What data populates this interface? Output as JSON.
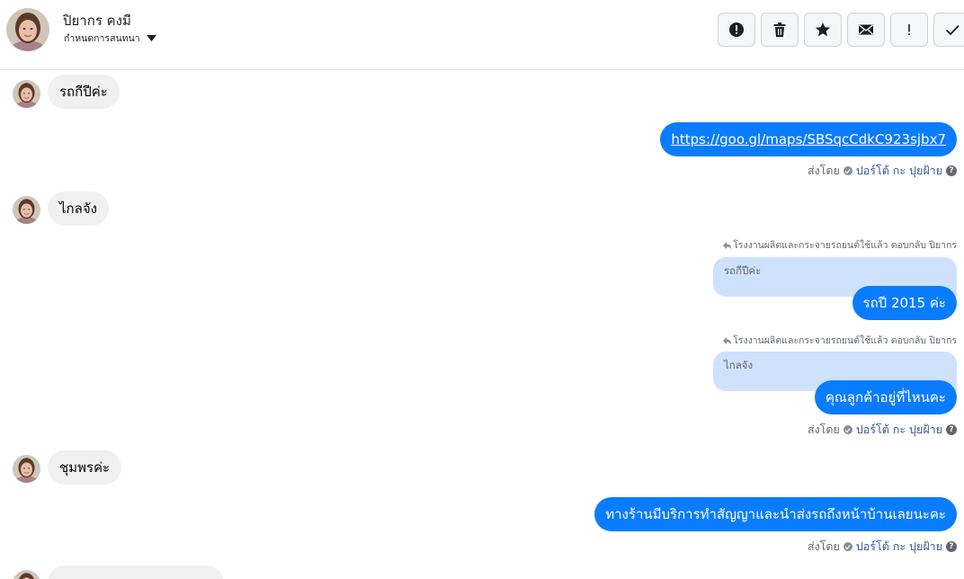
{
  "header": {
    "contact_name": "ปิยากร คงมี",
    "subtitle": "กำหนดการสนทนา",
    "actions": [
      {
        "icon": "alert-icon",
        "name": "mark-spam-button"
      },
      {
        "icon": "trash-icon",
        "name": "delete-button"
      },
      {
        "icon": "star-icon",
        "name": "star-button"
      },
      {
        "icon": "envelope-icon",
        "name": "mark-unread-button"
      },
      {
        "icon": "exclamation-icon",
        "name": "follow-up-button"
      },
      {
        "icon": "check-icon",
        "name": "done-button"
      }
    ]
  },
  "messages": {
    "m1": "รถกีปีค่ะ",
    "m2": "https://goo.gl/maps/SBSqcCdkC923sjbx7",
    "m3": "ไกลจัง",
    "m4_reply_note": "โรงงานผลิตและกระจายรถยนต์ใช้แล้ว ตอบกลับ ปิยากร",
    "m4_quote": "รถกีปีค่ะ",
    "m4": "รถปี 2015 ค่ะ",
    "m5_reply_note": "โรงงานผลิตและกระจายรถยนต์ใช้แล้ว ตอบกลับ ปิยากร",
    "m5_quote": "ไกลจัง",
    "m5": "คุณลูกค้าอยู่ที่ไหนคะ",
    "m6": "ชุมพรค่ะ",
    "m7": "ทางร้านมีบริการทำสัญญาและนำส่งรถถึงหน้าบ้านเลยนะคะ"
  },
  "sent_by": {
    "label": "ส่งโดย",
    "author": "ปอร์โต้ กะ ปุยฝ้าย"
  },
  "colors": {
    "outgoing": "#0a7cff",
    "incoming": "#f0f0f0",
    "quote": "#cfe2fd"
  }
}
